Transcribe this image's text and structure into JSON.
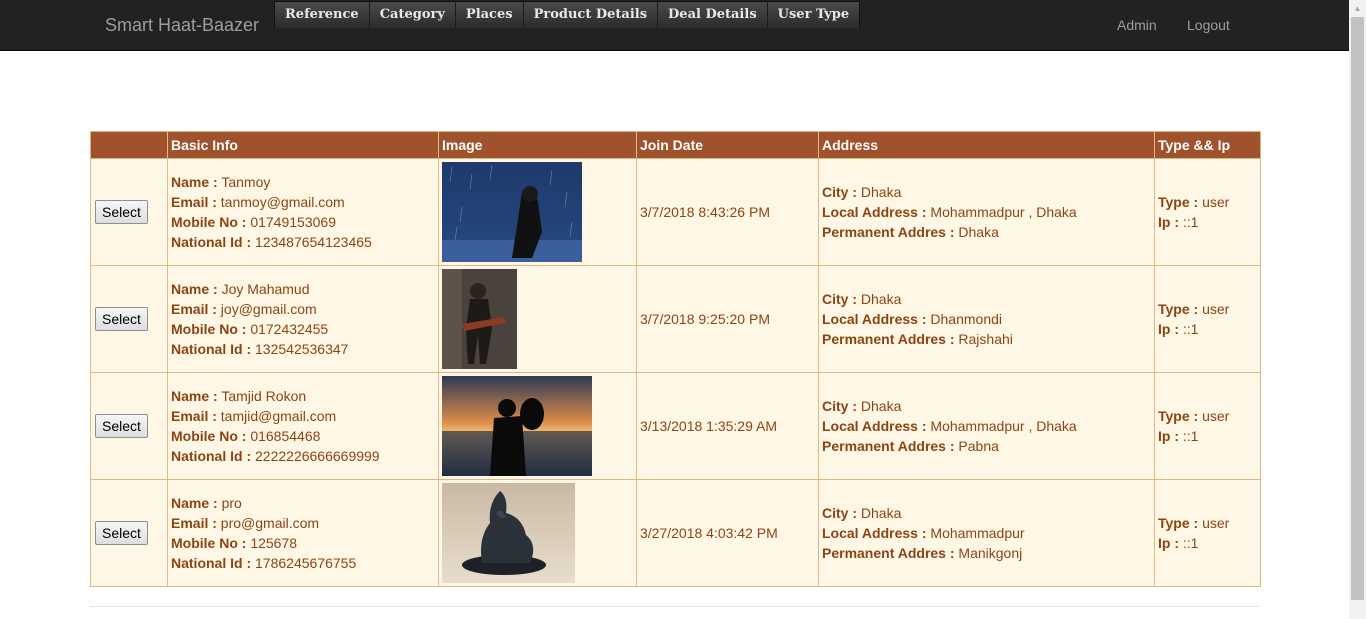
{
  "navbar": {
    "brand": "Smart Haat-Baazer",
    "menu": [
      "Reference",
      "Category",
      "Places",
      "Product Details",
      "Deal Details",
      "User Type"
    ],
    "admin": "Admin",
    "logout": "Logout"
  },
  "table": {
    "headers": [
      "",
      "Basic Info",
      "Image",
      "Join Date",
      "Address",
      "Type && Ip"
    ],
    "labels": {
      "name": "Name :",
      "email": "Email :",
      "mobile": "Mobile No :",
      "nid": "National Id :",
      "city": "City :",
      "local": "Local Address :",
      "permanent": "Permanent Addres :",
      "type": "Type :",
      "ip": "Ip :"
    },
    "select_label": "Select",
    "rows": [
      {
        "name": "Tanmoy",
        "email": "tanmoy@gmail.com",
        "mobile": "01749153069",
        "nid": "123487654123465",
        "join": "3/7/2018 8:43:26 PM",
        "city": "Dhaka",
        "local": "Mohammadpur , Dhaka",
        "permanent": "Dhaka",
        "type": "user",
        "ip": "::1"
      },
      {
        "name": "Joy Mahamud",
        "email": "joy@gmail.com",
        "mobile": "0172432455",
        "nid": "132542536347",
        "join": "3/7/2018 9:25:20 PM",
        "city": "Dhaka",
        "local": "Dhanmondi",
        "permanent": "Rajshahi",
        "type": "user",
        "ip": "::1"
      },
      {
        "name": "Tamjid Rokon",
        "email": "tamjid@gmail.com",
        "mobile": "016854468",
        "nid": "2222226666669999",
        "join": "3/13/2018 1:35:29 AM",
        "city": "Dhaka",
        "local": "Mohammadpur , Dhaka",
        "permanent": "Pabna",
        "type": "user",
        "ip": "::1"
      },
      {
        "name": "pro",
        "email": "pro@gmail.com",
        "mobile": "125678",
        "nid": "1786245676755",
        "join": "3/27/2018 4:03:42 PM",
        "city": "Dhaka",
        "local": "Mohammadpur",
        "permanent": "Manikgonj",
        "type": "user",
        "ip": "::1"
      }
    ]
  }
}
